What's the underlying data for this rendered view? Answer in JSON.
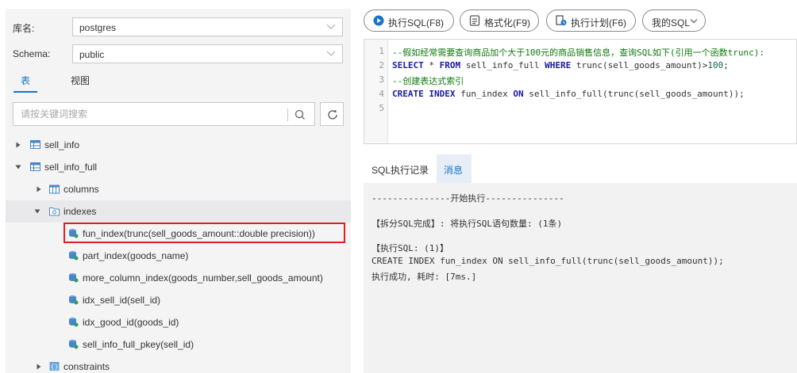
{
  "left": {
    "db_label": "库名:",
    "db_value": "postgres",
    "schema_label": "Schema:",
    "schema_value": "public",
    "tab_table": "表",
    "tab_view": "视图",
    "search_placeholder": "请按关键词搜索"
  },
  "tree": {
    "sell_info": "sell_info",
    "sell_info_full": "sell_info_full",
    "columns": "columns",
    "indexes": "indexes",
    "idx_fun_index": "fun_index(trunc(sell_goods_amount::double precision))",
    "idx_part_index": "part_index(goods_name)",
    "idx_more_column": "more_column_index(goods_number,sell_goods_amount)",
    "idx_sell_id": "idx_sell_id(sell_id)",
    "idx_good_id": "idx_good_id(goods_id)",
    "idx_pkey": "sell_info_full_pkey(sell_id)",
    "constraints": "constraints"
  },
  "toolbar": {
    "run": "执行SQL(F8)",
    "format": "格式化(F9)",
    "plan": "执行计划(F6)",
    "my_sql": "我的SQL"
  },
  "editor": {
    "line_numbers": [
      "1",
      "2",
      "3",
      "4",
      "5"
    ],
    "line1": "--假如经常需要查询商品加个大于100元的商品销售信息，查询SQL如下(引用一个函数trunc):",
    "line2_kw1": "SELECT",
    "line2_a": " * ",
    "line2_kw2": "FROM",
    "line2_b": " sell_info_full ",
    "line2_kw3": "WHERE",
    "line2_c": " trunc(sell_goods_amount)>",
    "line2_num": "100",
    "line2_d": ";",
    "line3": "--创建表达式索引",
    "line4_kw1": "CREATE",
    "line4_kw2": "INDEX",
    "line4_a": " fun_index ",
    "line4_kw3": "ON",
    "line4_b": " sell_info_full(trunc(sell_goods_amount));"
  },
  "bottom_tabs": {
    "history": "SQL执行记录",
    "messages": "消息"
  },
  "output": {
    "line1": "---------------开始执行---------------",
    "line2": "【拆分SQL完成】: 将执行SQL语句数量: (1条)",
    "line3": "【执行SQL: (1)】",
    "line4": "CREATE INDEX fun_index ON sell_info_full(trunc(sell_goods_amount));",
    "line5": "执行成功, 耗时: [7ms.]"
  },
  "colors": {
    "accent": "#1a73c8",
    "highlight": "#e02020",
    "panel_bg": "#f4f4f5"
  }
}
